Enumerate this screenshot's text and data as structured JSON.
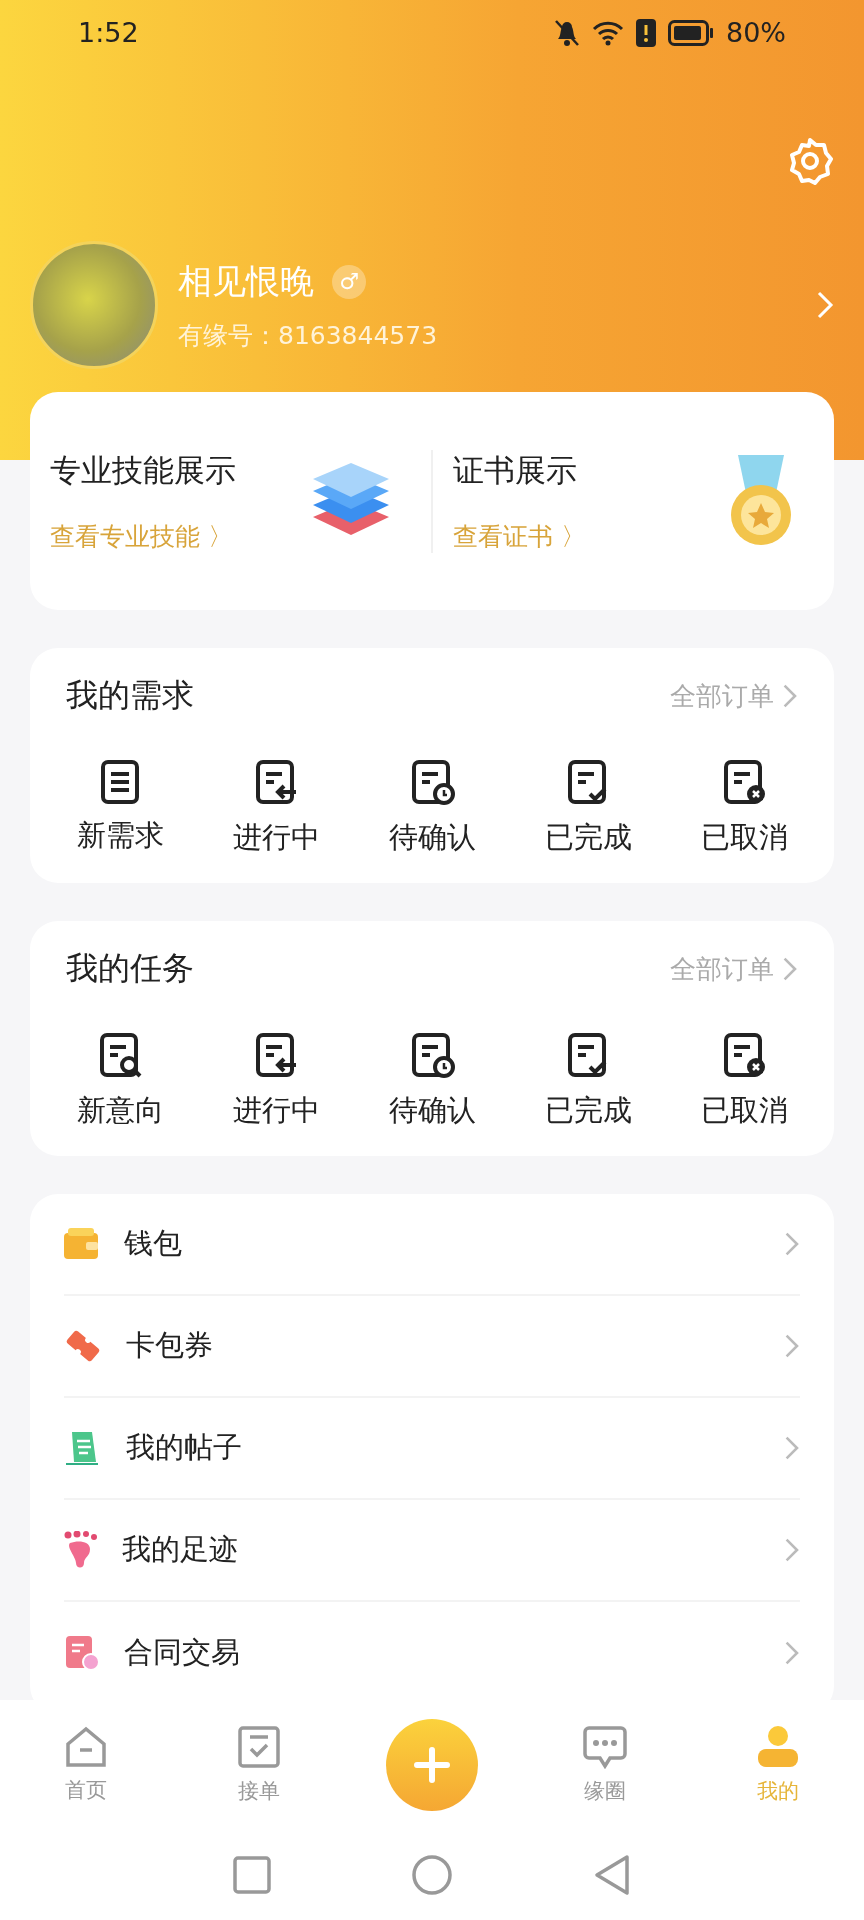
{
  "status_bar": {
    "time": "1:52",
    "battery": "80%"
  },
  "profile": {
    "name": "相见恨晚",
    "gender": "♂",
    "id_label": "有缘号：8163844573"
  },
  "showcase": [
    {
      "kind": "skills",
      "title": "专业技能展示",
      "link": "查看专业技能 〉"
    },
    {
      "kind": "certificate",
      "title": "证书展示",
      "link": "查看证书 〉"
    }
  ],
  "sections": [
    {
      "title": "我的需求",
      "more": "全部订单",
      "actions": [
        {
          "kind": "list",
          "label": "新需求"
        },
        {
          "kind": "arrow",
          "label": "进行中"
        },
        {
          "kind": "clock",
          "label": "待确认"
        },
        {
          "kind": "check",
          "label": "已完成"
        },
        {
          "kind": "cancel",
          "label": "已取消"
        }
      ]
    },
    {
      "title": "我的任务",
      "more": "全部订单",
      "actions": [
        {
          "kind": "search",
          "label": "新意向"
        },
        {
          "kind": "arrow",
          "label": "进行中"
        },
        {
          "kind": "clock",
          "label": "待确认"
        },
        {
          "kind": "check",
          "label": "已完成"
        },
        {
          "kind": "cancel",
          "label": "已取消"
        }
      ]
    }
  ],
  "menu": [
    {
      "kind": "wallet",
      "label": "钱包"
    },
    {
      "kind": "ticket",
      "label": "卡包券"
    },
    {
      "kind": "post",
      "label": "我的帖子"
    },
    {
      "kind": "footprint",
      "label": "我的足迹"
    },
    {
      "kind": "contract",
      "label": "合同交易"
    }
  ],
  "tab_bar": [
    {
      "kind": "home",
      "label": "首页",
      "selected": false
    },
    {
      "kind": "orders",
      "label": "接单",
      "selected": false
    },
    {
      "kind": "add",
      "selected": false
    },
    {
      "kind": "chat",
      "label": "缘圈",
      "selected": false
    },
    {
      "kind": "user",
      "label": "我的",
      "selected": true
    }
  ]
}
